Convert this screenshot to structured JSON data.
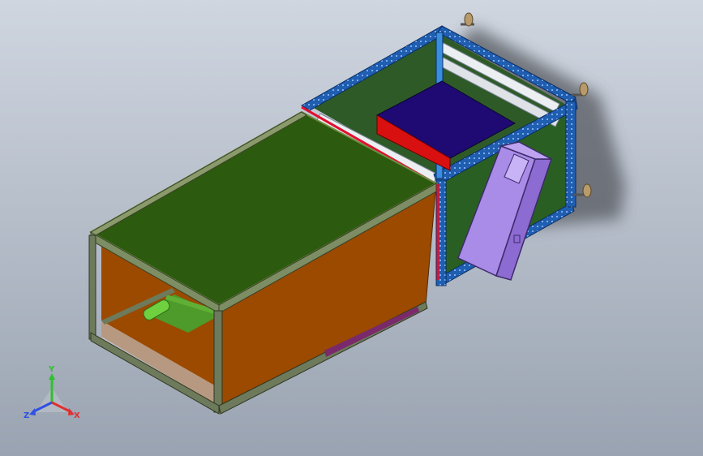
{
  "viewport": {
    "background_top": "#cfd6e0",
    "background_bottom": "#9aa3b1"
  },
  "triad": {
    "x_label": "X",
    "y_label": "Y",
    "z_label": "Z",
    "x_color": "#e03030",
    "y_color": "#30c030",
    "z_color": "#3050e0"
  },
  "model": {
    "colors": {
      "top_panel": "#2c5a0f",
      "side_panel": "#9b4a00",
      "rear_back_panel": "#2f6a2c",
      "frame_blue": "#1f5eb0",
      "frame_light": "#3a8ee0",
      "rail_white": "#eceff2",
      "box_top": "#1f0a73",
      "box_side": "#d81010",
      "cabinet": "#a98be8",
      "cylinder": "#6fd040",
      "divider_red": "#e01030",
      "shadow": "#55595f"
    }
  }
}
